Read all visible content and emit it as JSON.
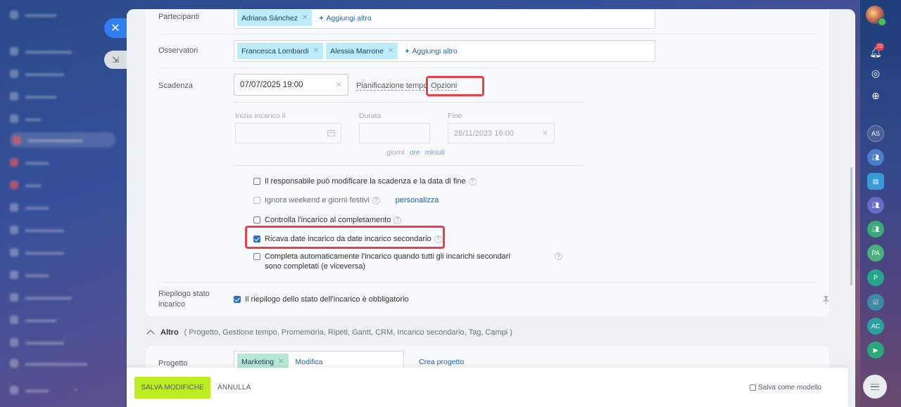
{
  "form": {
    "participants": {
      "label": "Partecipanti",
      "tags": [
        "Adriana Sánchez"
      ],
      "add_label": "Aggiungi altro"
    },
    "observers": {
      "label": "Osservatori",
      "tags": [
        "Francesca Lombardi",
        "Alessia Marrone"
      ],
      "add_label": "Aggiungi altro"
    },
    "deadline": {
      "label": "Scadenza",
      "value": "07/07/2025 19:00",
      "planning_label": "Pianificazione tempo",
      "options_label": "Opzioni",
      "start_label": "Inizia incarico il",
      "duration_label": "Durata",
      "end_label": "Fine",
      "end_value": "28/11/2023 16:00",
      "unit_days": "giorni",
      "unit_hours": "ore",
      "unit_minutes": "minuti"
    },
    "checkboxes": [
      {
        "label": "Il responsabile può modificare la scadenza e la data di fine",
        "checked": false
      },
      {
        "label": "Ignora weekend e giorni festivi",
        "checked": false,
        "link": "personalizza"
      },
      {
        "label": "Controlla l'incarico al completamento",
        "checked": false
      },
      {
        "label": "Ricava date incarico da date incarico secondario",
        "checked": true
      },
      {
        "label": "Completa automaticamente l'incarico quando tutti gli incarichi secondari sono completati (e viceversa)",
        "checked": false
      }
    ],
    "summary": {
      "label": "Riepilogo stato incarico",
      "checkbox_label": "Il riepilogo dello stato dell'incarico è obbligatorio",
      "checked": true
    },
    "other": {
      "label": "Altro",
      "items": "( Progetto,  Gestione tempo,  Promemoria,  Ripeti,  Gantt,  CRM,  Incarico secondario,  Tag,  Campi )"
    },
    "project": {
      "label": "Progetto",
      "tag": "Marketing",
      "modify_label": "Modifica",
      "create_label": "Crea progetto"
    }
  },
  "footer": {
    "save_label": "SALVA MODIFICHE",
    "cancel_label": "ANNULLA",
    "template_label": "Salva come modello"
  },
  "right_sidebar": {
    "notification_count": "22",
    "avatars": [
      "AS",
      "PA",
      "P",
      "AC"
    ]
  },
  "colors": {
    "accent": "#2f7ff0",
    "save_button": "#bbed21",
    "highlight": "#e8414b",
    "tag": "#bcedfc",
    "tag_project": "#b6e9d3"
  }
}
